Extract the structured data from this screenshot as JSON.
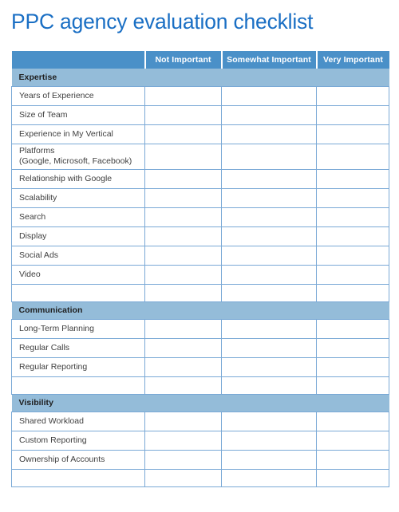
{
  "page": {
    "title": "PPC agency evaluation checklist"
  },
  "table": {
    "columns": [
      {
        "key": "item",
        "label": ""
      },
      {
        "key": "not_important",
        "label": "Not Important"
      },
      {
        "key": "somewhat_important",
        "label": "Somewhat Important"
      },
      {
        "key": "very_important",
        "label": "Very Important"
      }
    ],
    "rows": [
      {
        "type": "section",
        "label": "Expertise"
      },
      {
        "type": "item",
        "label": "Years of Experience"
      },
      {
        "type": "item",
        "label": "Size of Team"
      },
      {
        "type": "item",
        "label": "Experience in My Vertical"
      },
      {
        "type": "item",
        "label": "Platforms",
        "label2": "(Google, Microsoft, Facebook)"
      },
      {
        "type": "item",
        "label": "Relationship with Google"
      },
      {
        "type": "item",
        "label": "Scalability"
      },
      {
        "type": "item",
        "label": "Search"
      },
      {
        "type": "item",
        "label": "Display"
      },
      {
        "type": "item",
        "label": "Social Ads"
      },
      {
        "type": "item",
        "label": "Video"
      },
      {
        "type": "spacer",
        "label": ""
      },
      {
        "type": "section",
        "label": "Communication"
      },
      {
        "type": "item",
        "label": "Long-Term Planning"
      },
      {
        "type": "item",
        "label": "Regular Calls"
      },
      {
        "type": "item",
        "label": "Regular Reporting"
      },
      {
        "type": "spacer",
        "label": ""
      },
      {
        "type": "section",
        "label": "Visibility"
      },
      {
        "type": "item",
        "label": "Shared Workload"
      },
      {
        "type": "item",
        "label": "Custom Reporting"
      },
      {
        "type": "item",
        "label": "Ownership of Accounts"
      },
      {
        "type": "spacer",
        "label": ""
      }
    ]
  },
  "colors": {
    "title_blue": "#1a6fc4",
    "header_blue": "#4a90c8",
    "section_blue": "#94bcd9",
    "border_blue": "#7aa9d6",
    "text_dark": "#404040"
  }
}
